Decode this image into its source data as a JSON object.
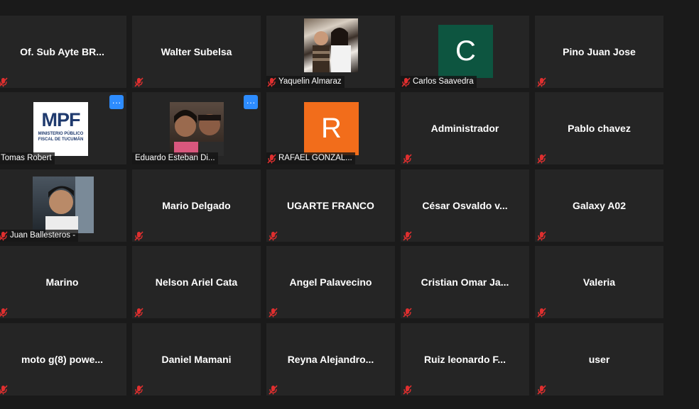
{
  "app": "Zoom Meeting Gallery View",
  "colors": {
    "tile_bg": "#252525",
    "background": "#1a1a1a",
    "accent": "#2d8cff",
    "mute": "#e02f2f",
    "avatar_green": "#0d5540",
    "avatar_orange": "#f26d1b"
  },
  "participants": [
    {
      "name": "Of. Sub Ayte BR...",
      "display": "text",
      "muted": true
    },
    {
      "name": "Walter Subelsa",
      "display": "text",
      "muted": true
    },
    {
      "name": "Yaquelin Almaraz",
      "display": "photo",
      "muted": true
    },
    {
      "name": "Carlos Saavedra",
      "display": "letter",
      "letter": "C",
      "muted": true
    },
    {
      "name": "Pino Juan Jose",
      "display": "text",
      "muted": true
    },
    {
      "name": "Tomas Robert",
      "display": "logo",
      "muted": false,
      "logo_title": "MPF",
      "logo_line1": "MINISTERIO PÚBLICO",
      "logo_line2": "FISCAL DE TUCUMÁN",
      "more": "···"
    },
    {
      "name": "Eduardo Esteban Di...",
      "display": "photo",
      "muted": false,
      "more": "···"
    },
    {
      "name": "RAFAEL GONZAL...",
      "display": "letter",
      "letter": "R",
      "muted": true
    },
    {
      "name": "Administrador",
      "display": "text",
      "muted": true
    },
    {
      "name": "Pablo chavez",
      "display": "text",
      "muted": true
    },
    {
      "name": "Juan Ballesteros -",
      "display": "photo",
      "muted": true
    },
    {
      "name": "Mario Delgado",
      "display": "text",
      "muted": true
    },
    {
      "name": "UGARTE FRANCO",
      "display": "text",
      "muted": true
    },
    {
      "name": "César Osvaldo v...",
      "display": "text",
      "muted": true
    },
    {
      "name": "Galaxy A02",
      "display": "text",
      "muted": true
    },
    {
      "name": "Marino",
      "display": "text",
      "muted": true
    },
    {
      "name": "Nelson Ariel Cata",
      "display": "text",
      "muted": true
    },
    {
      "name": "Angel Palavecino",
      "display": "text",
      "muted": true
    },
    {
      "name": "Cristian Omar Ja...",
      "display": "text",
      "muted": true
    },
    {
      "name": "Valeria",
      "display": "text",
      "muted": true
    },
    {
      "name": "moto g(8) powe...",
      "display": "text",
      "muted": true
    },
    {
      "name": "Daniel Mamani",
      "display": "text",
      "muted": true
    },
    {
      "name": "Reyna Alejandro...",
      "display": "text",
      "muted": true
    },
    {
      "name": "Ruiz leonardo F...",
      "display": "text",
      "muted": true
    },
    {
      "name": "user",
      "display": "text",
      "muted": true
    }
  ]
}
